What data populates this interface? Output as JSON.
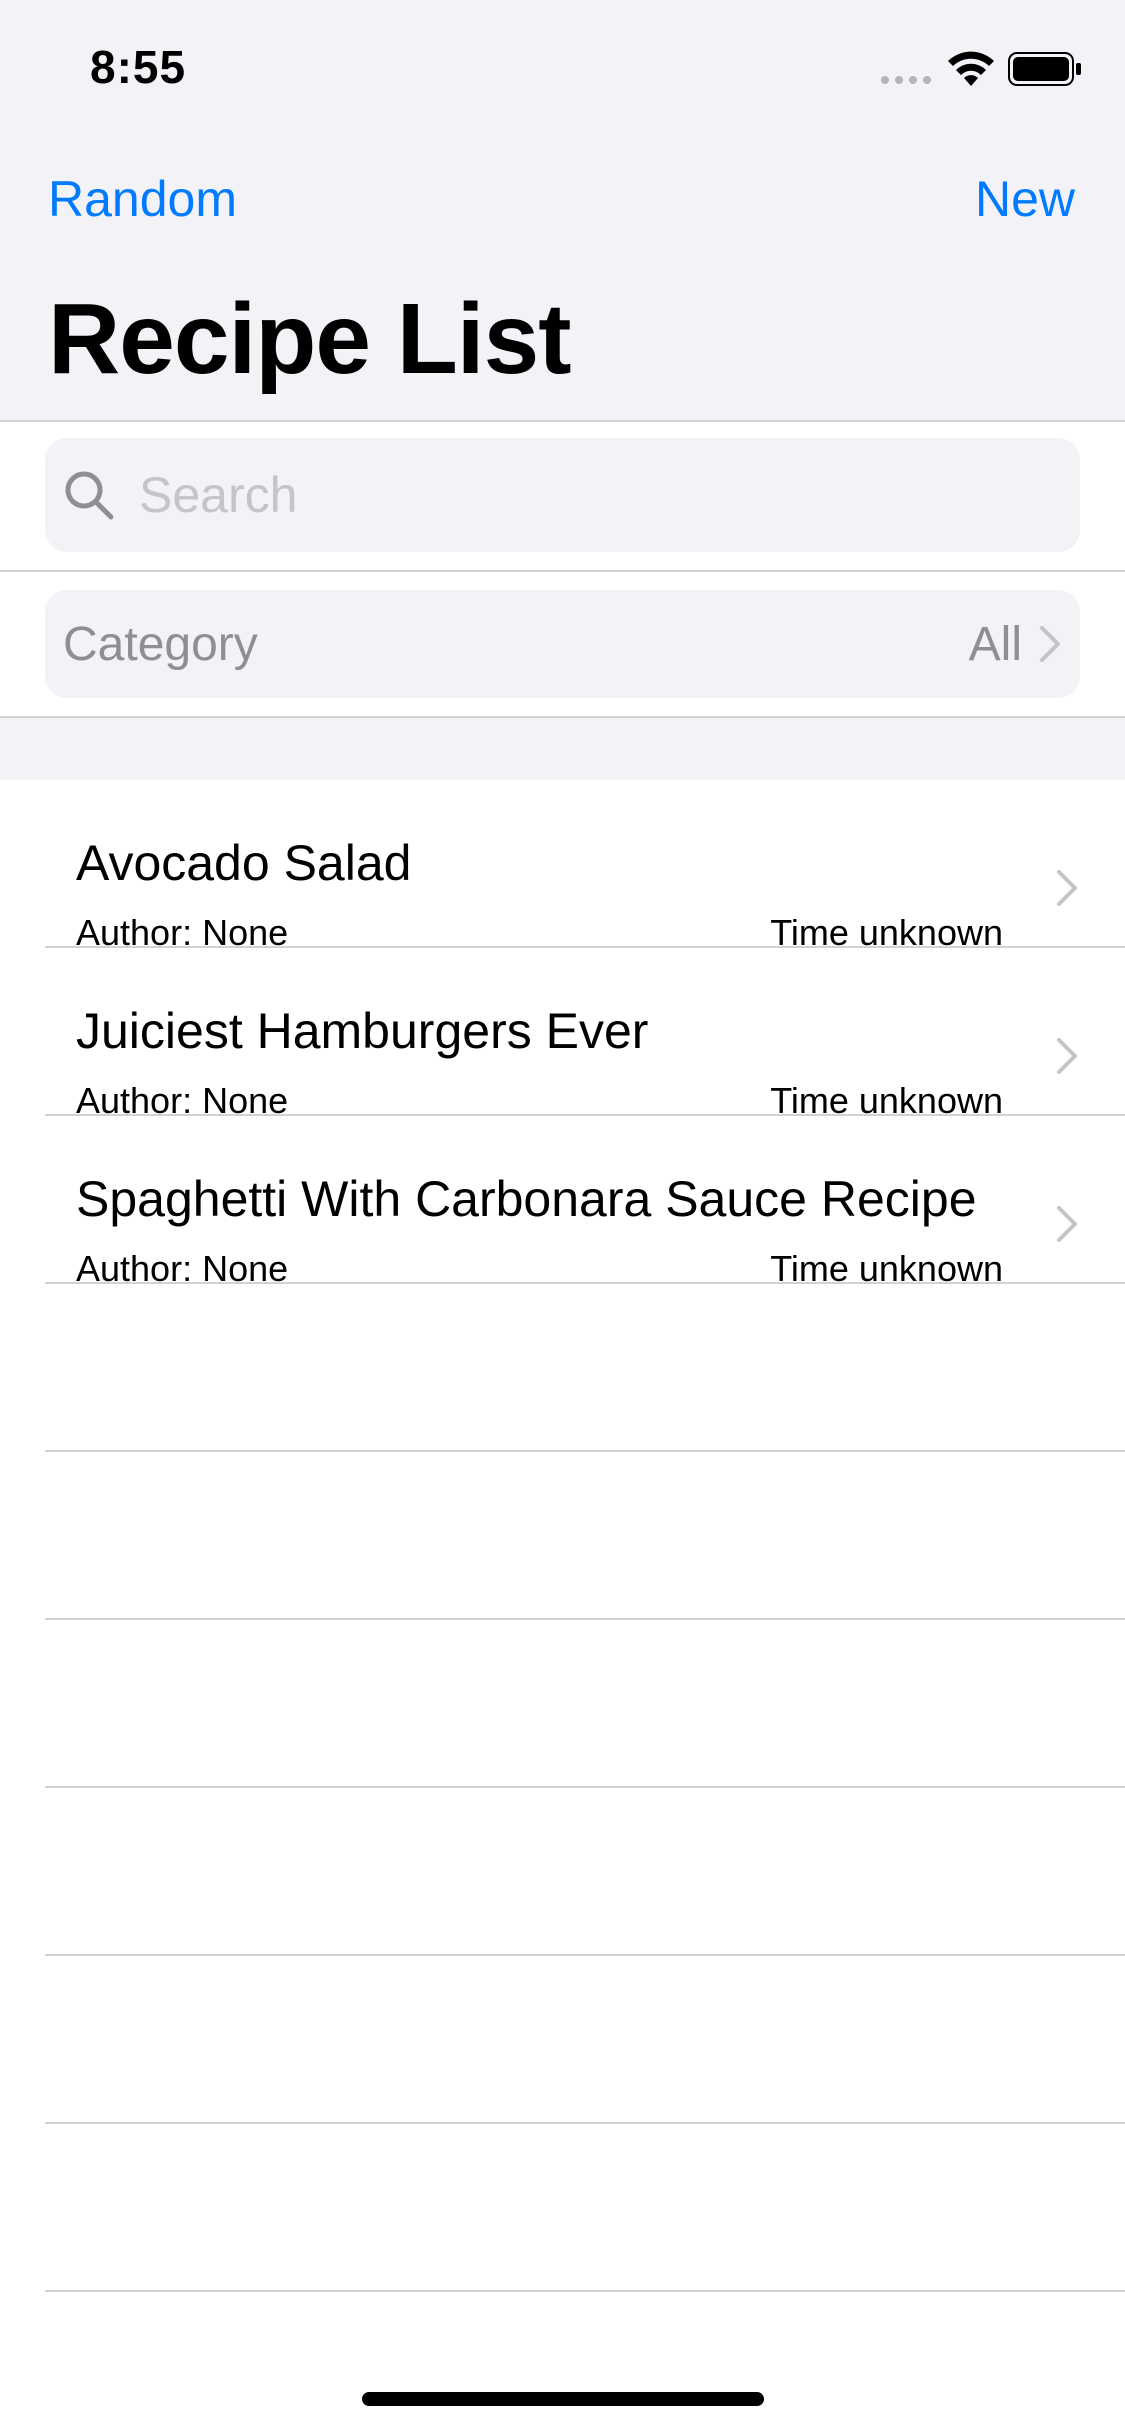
{
  "status_bar": {
    "time": "8:55"
  },
  "nav": {
    "left_button": "Random",
    "right_button": "New",
    "title": "Recipe List"
  },
  "search": {
    "placeholder": "Search",
    "value": ""
  },
  "filter": {
    "label": "Category",
    "value": "All"
  },
  "recipes": [
    {
      "title": "Avocado Salad",
      "author": "Author: None",
      "time": "Time unknown"
    },
    {
      "title": "Juiciest Hamburgers Ever",
      "author": "Author: None",
      "time": "Time unknown"
    },
    {
      "title": "Spaghetti With Carbonara Sauce Recipe",
      "author": "Author: None",
      "time": "Time unknown"
    }
  ],
  "colors": {
    "accent": "#007aff",
    "background_grouped": "#f2f2f7",
    "separator": "#d1d1d6",
    "secondary_text": "#8e8e93"
  },
  "icons": {
    "search": "search-icon",
    "chevron": "chevron-right-icon",
    "wifi": "wifi-icon",
    "battery": "battery-icon"
  }
}
